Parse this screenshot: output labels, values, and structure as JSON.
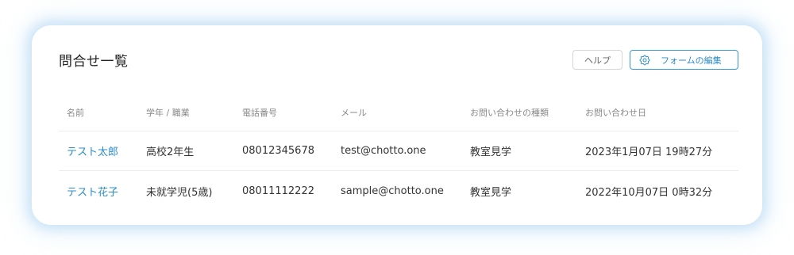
{
  "page": {
    "title": "問合せ一覧"
  },
  "toolbar": {
    "help_label": "ヘルプ",
    "edit_form_label": "フォームの編集",
    "edit_icon": "gear-icon"
  },
  "colors": {
    "accent": "#2b8ccc",
    "border": "#ececec"
  },
  "table": {
    "headers": [
      "名前",
      "学年 / 職業",
      "電話番号",
      "メール",
      "お問い合わせの種類",
      "お問い合わせ日"
    ],
    "rows": [
      {
        "name": "テスト太郎",
        "grade": "高校2年生",
        "phone": "08012345678",
        "email": "test@chotto.one",
        "type": "教室見学",
        "date": "2023年1月07日 19時27分"
      },
      {
        "name": "テスト花子",
        "grade": "未就学児(5歳)",
        "phone": "08011112222",
        "email": "sample@chotto.one",
        "type": "教室見学",
        "date": "2022年10月07日 0時32分"
      }
    ]
  }
}
